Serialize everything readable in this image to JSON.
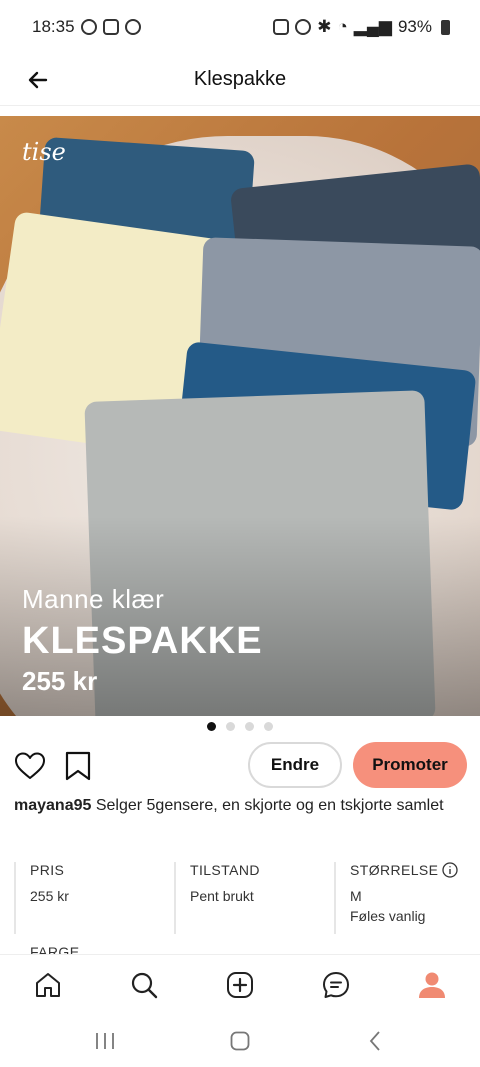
{
  "status_bar": {
    "time": "18:35",
    "battery": "93%"
  },
  "app_bar": {
    "title": "Klespakke"
  },
  "hero": {
    "logo": "tise",
    "subtitle": "Manne klær",
    "title": "KLESPAKKE",
    "price": "255 kr"
  },
  "carousel": {
    "count": 4,
    "active_index": 0
  },
  "actions": {
    "edit_label": "Endre",
    "promote_label": "Promoter"
  },
  "description": {
    "username": "mayana95",
    "text": " Selger 5gensere, en skjorte og en tskjorte samlet"
  },
  "properties": {
    "price": {
      "label": "PRIS",
      "value": "255 kr"
    },
    "condition": {
      "label": "TILSTAND",
      "value": "Pent brukt"
    },
    "size": {
      "label": "STØRRELSE",
      "value": "M",
      "note": "Føles vanlig"
    },
    "color": {
      "label": "FARGE"
    }
  },
  "bottom_nav": [
    "home-icon",
    "search-icon",
    "add-icon",
    "chat-icon",
    "profile-icon"
  ],
  "colors": {
    "accent": "#f6907c",
    "profile_active": "#f08a72"
  }
}
